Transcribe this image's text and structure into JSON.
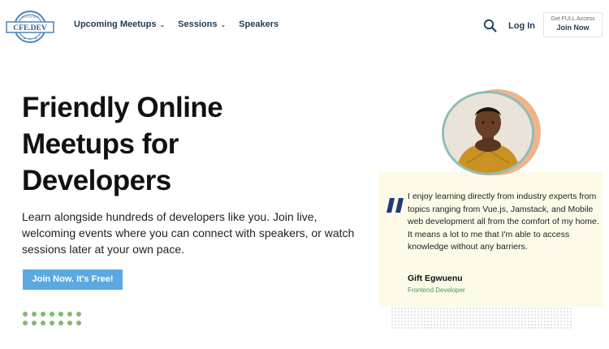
{
  "header": {
    "logo": {
      "text": "CFE.DEV",
      "arc_text": "CERTIFIED"
    },
    "nav": [
      {
        "label": "Upcoming Meetups",
        "has_dropdown": true
      },
      {
        "label": "Sessions",
        "has_dropdown": true
      },
      {
        "label": "Speakers",
        "has_dropdown": false
      }
    ],
    "search_icon": "search-icon",
    "login_label": "Log In",
    "join": {
      "top": "Get FULL Access",
      "label": "Join Now"
    }
  },
  "hero": {
    "title_lines": [
      "Friendly Online",
      "Meetups for",
      "Developers"
    ],
    "description": "Learn alongside hundreds of developers like you. Join live, welcoming events where you can connect with speakers, or watch sessions later at your own pace.",
    "cta_label": "Join Now. It's Free!"
  },
  "testimonial": {
    "quote": "I enjoy learning directly from industry experts from topics ranging from Vue.js, Jamstack, and Mobile web development all from the comfort of my home. It means a lot to me that I'm able to access knowledge without any barriers.",
    "name": "Gift Egwuenu",
    "role": "Frontend Developer"
  },
  "colors": {
    "nav_text": "#1f3b57",
    "cta": "#5ba8e2",
    "quote_mark": "#1f3b77",
    "card_bg": "#fdfbe8",
    "dots": "#86b86e",
    "role_text": "#4f8f5a"
  }
}
